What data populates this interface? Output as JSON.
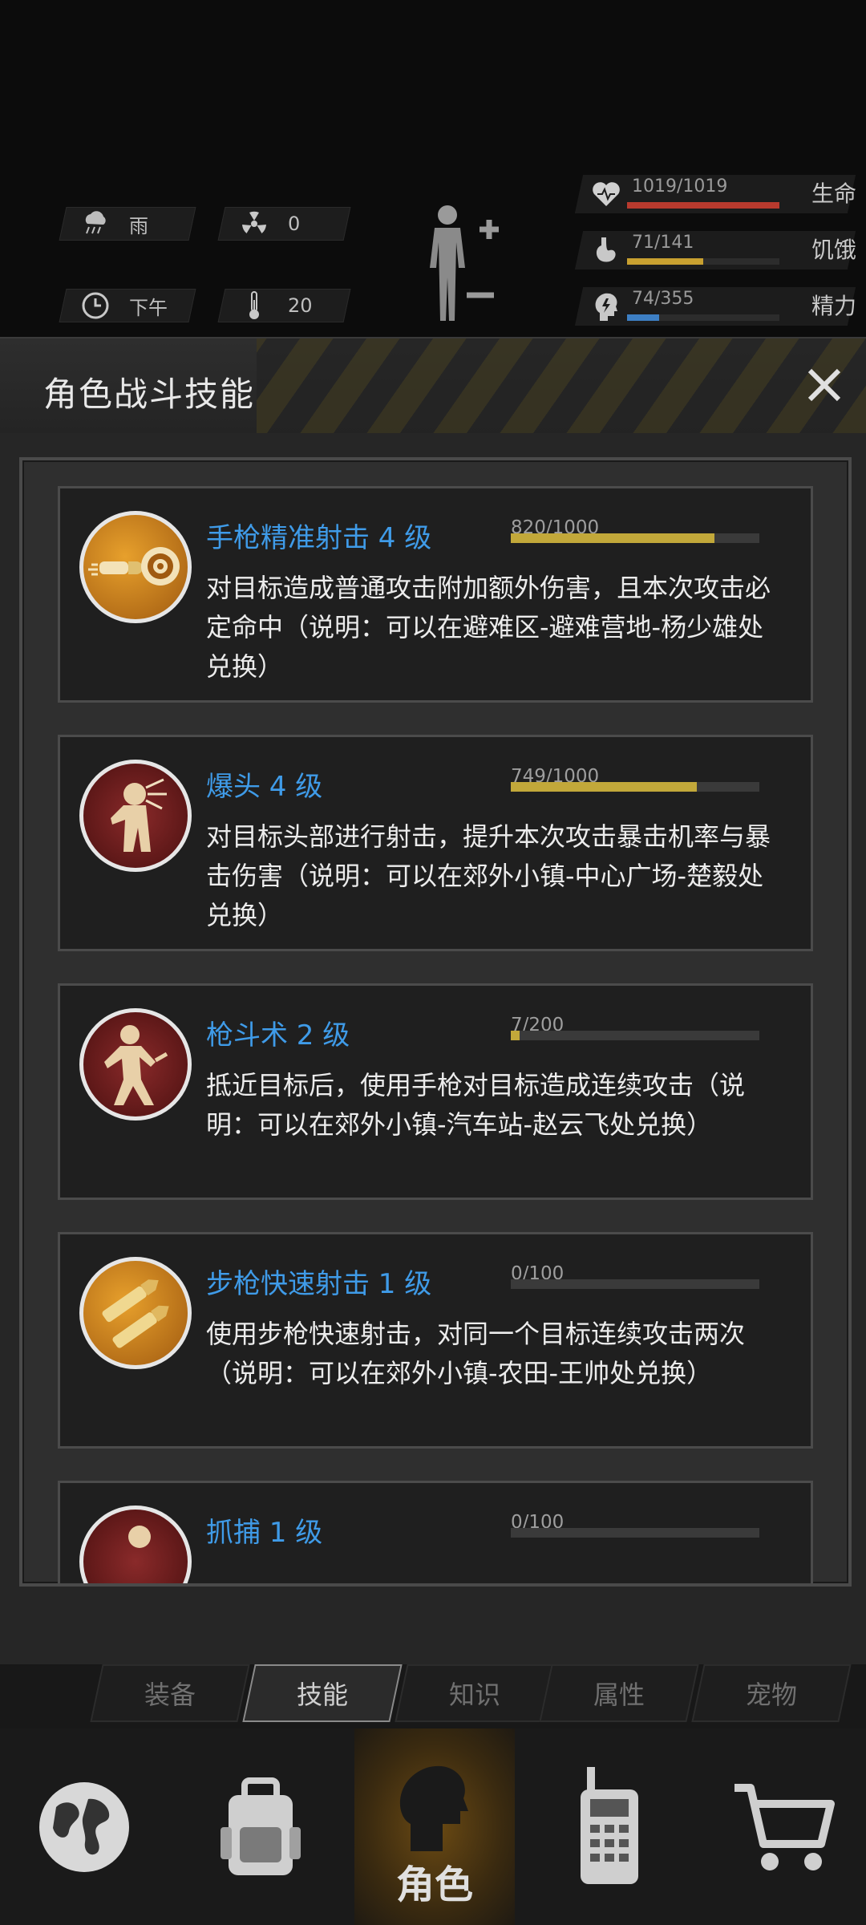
{
  "status": {
    "weather": "雨",
    "radiation": "0",
    "time_of_day": "下午",
    "temperature": "20"
  },
  "vitals": [
    {
      "value": "1019/1019",
      "label": "生命",
      "fill": 1.0,
      "color": "#b83a2e",
      "icon": "heart-icon"
    },
    {
      "value": "71/141",
      "label": "饥饿",
      "fill": 0.5,
      "color": "#c8a030",
      "icon": "stomach-icon"
    },
    {
      "value": "74/355",
      "label": "精力",
      "fill": 0.21,
      "color": "#3d7fc4",
      "icon": "energy-head-icon"
    }
  ],
  "panel": {
    "title": "角色战斗技能"
  },
  "skills": [
    {
      "name": "手枪精准射击 4 级",
      "progress_text": "820/1000",
      "progress": 0.82,
      "desc": "对目标造成普通攻击附加额外伤害，且本次攻击必定命中（说明：可以在避难区-避难营地-杨少雄处兑换）",
      "icon": "pistol-bullet-target-icon"
    },
    {
      "name": "爆头 4 级",
      "progress_text": "749/1000",
      "progress": 0.749,
      "desc": "对目标头部进行射击，提升本次攻击暴击机率与暴击伤害（说明：可以在郊外小镇-中心广场-楚毅处兑换）",
      "icon": "headshot-icon"
    },
    {
      "name": "枪斗术 2 级",
      "progress_text": "7/200",
      "progress": 0.035,
      "desc": "抵近目标后，使用手枪对目标造成连续攻击（说明：可以在郊外小镇-汽车站-赵云飞处兑换）",
      "icon": "gun-kata-icon"
    },
    {
      "name": "步枪快速射击 1 级",
      "progress_text": "0/100",
      "progress": 0,
      "desc": "使用步枪快速射击，对同一个目标连续攻击两次（说明：可以在郊外小镇-农田-王帅处兑换）",
      "icon": "rifle-bullets-icon"
    },
    {
      "name": "抓捕 1 级",
      "progress_text": "0/100",
      "progress": 0,
      "desc": "",
      "icon": "capture-icon"
    }
  ],
  "sub_tabs": [
    "装备",
    "技能",
    "知识",
    "属性",
    "宠物"
  ],
  "bottom_nav": {
    "active_label": "角色"
  }
}
